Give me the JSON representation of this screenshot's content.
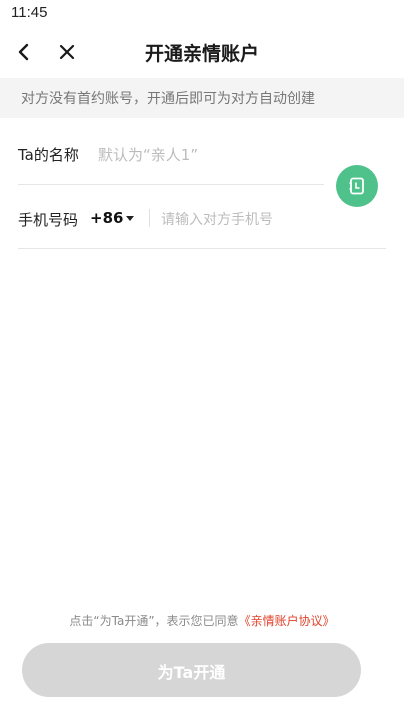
{
  "status_bar": {
    "time": "11:45"
  },
  "nav": {
    "title": "开通亲情账户",
    "back_icon": "chevron-left-icon",
    "close_icon": "close-icon"
  },
  "notice": {
    "text": "对方没有首约账号，开通后即可为对方自动创建"
  },
  "form": {
    "name": {
      "label": "Ta的名称",
      "placeholder": "默认为“亲人1”"
    },
    "phone": {
      "label": "手机号码",
      "country_code": "+86",
      "placeholder": "请输入对方手机号"
    },
    "contact_button": {
      "icon": "contact-book-icon",
      "color": "#4ec28a"
    }
  },
  "agreement": {
    "prefix": "点击“为Ta开通”，表示您已同意",
    "link": "《亲情账户协议》",
    "link_color": "#e0412a"
  },
  "submit": {
    "label": "为Ta开通",
    "enabled": false,
    "color": "#d6d6d6"
  }
}
